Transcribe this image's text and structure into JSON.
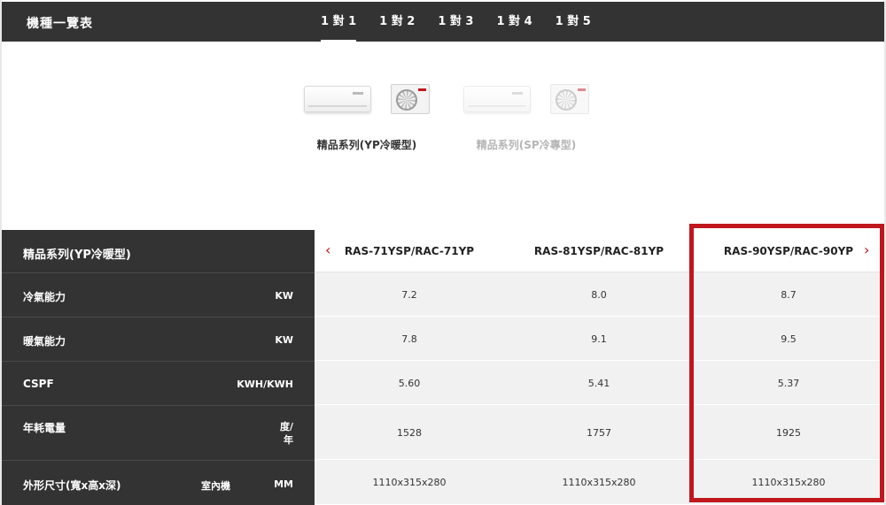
{
  "header": {
    "title": "機種一覽表",
    "tabs": [
      {
        "label": "1 對 1",
        "active": true
      },
      {
        "label": "1 對 2",
        "active": false
      },
      {
        "label": "1 對 3",
        "active": false
      },
      {
        "label": "1 對 4",
        "active": false
      },
      {
        "label": "1 對 5",
        "active": false
      }
    ]
  },
  "series": [
    {
      "label": "精品系列(YP冷暖型)",
      "selected": true
    },
    {
      "label": "精品系列(SP冷專型)",
      "selected": false
    }
  ],
  "table": {
    "heading": "精品系列(YP冷暖型)",
    "models": [
      "RAS-71YSP/RAC-71YP",
      "RAS-81YSP/RAC-81YP",
      "RAS-90YSP/RAC-90YP"
    ],
    "prev_icon": "‹",
    "next_icon": "›",
    "rows": [
      {
        "label": "冷氣能力",
        "sub": "",
        "unit": "KW",
        "values": [
          "7.2",
          "8.0",
          "8.7"
        ]
      },
      {
        "label": "暖氣能力",
        "sub": "",
        "unit": "KW",
        "values": [
          "7.8",
          "9.1",
          "9.5"
        ]
      },
      {
        "label": "CSPF",
        "sub": "",
        "unit": "KWH/KWH",
        "values": [
          "5.60",
          "5.41",
          "5.37"
        ]
      },
      {
        "label": "年耗電量",
        "sub": "",
        "unit": "度/\n年",
        "values": [
          "1528",
          "1757",
          "1925"
        ]
      },
      {
        "label": "外形尺寸(寬x高x深)",
        "sub": "室內機",
        "unit": "MM",
        "values": [
          "1110x315x280",
          "1110x315x280",
          "1110x315x280"
        ]
      }
    ]
  },
  "colors": {
    "dark": "#333333",
    "accent": "#c0161e",
    "cell_bg": "#f1f1f1"
  }
}
